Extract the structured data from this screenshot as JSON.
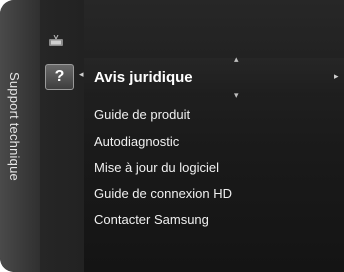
{
  "side_title": "Support technique",
  "icons": {
    "top": "tv-antenna-icon",
    "help": "help-question-icon"
  },
  "help_symbol": "?",
  "selected_item": "Avis juridique",
  "menu": [
    "Guide de produit",
    "Autodiagnostic",
    "Mise à jour du logiciel",
    "Guide de connexion HD",
    "Contacter Samsung"
  ],
  "colors": {
    "panel": "#1e1e1e",
    "side_bar": "#3a3a3a",
    "text": "#f0f0f0"
  }
}
